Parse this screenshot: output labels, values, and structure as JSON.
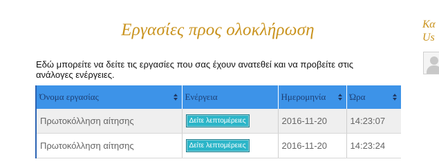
{
  "page": {
    "title": "Εργασίες προς ολοκλήρωση",
    "intro": "Εδώ μπορείτε να δείτε τις εργασίες που σας έχουν ανατεθεί και να προβείτε στις ανάλογες ενέργειες."
  },
  "table": {
    "columns": [
      "Όνομα εργασίας",
      "Ενέργεια",
      "Ημερομηνία",
      "Ώρα"
    ],
    "rows": [
      {
        "name": "Πρωτοκόλληση αίτησης",
        "action": "Δείτε λεπτομέρειες",
        "date": "2016-11-20",
        "time": "14:23:07"
      },
      {
        "name": "Πρωτοκόλληση αίτησης",
        "action": "Δείτε λεπτομέρειες",
        "date": "2016-11-20",
        "time": "14:23:24"
      }
    ]
  },
  "sidebar": {
    "title_line1": "Κα",
    "title_line2": "Us"
  },
  "colors": {
    "title": "#c9931e",
    "header_bg": "#3d93e8",
    "button_bg": "#2bb5c8"
  }
}
